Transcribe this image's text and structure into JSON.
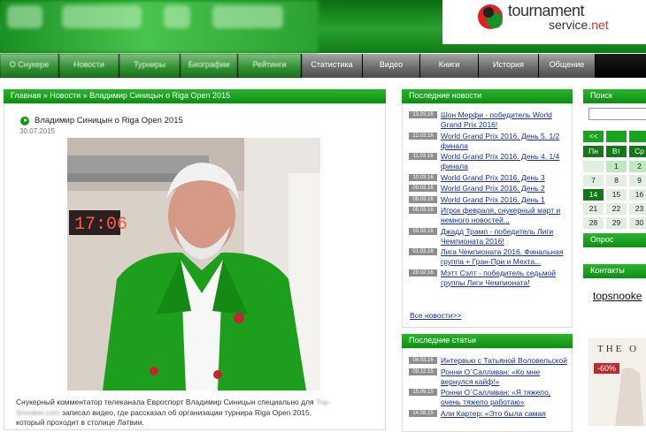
{
  "header": {
    "logo_line1": "tournament",
    "logo_line2": "service",
    "logo_tld": ".net"
  },
  "nav": [
    {
      "label": "О Снукере",
      "w": 67
    },
    {
      "label": "Новости",
      "w": 68
    },
    {
      "label": "Турниры",
      "w": 69
    },
    {
      "label": "Биографии",
      "w": 65
    },
    {
      "label": "Рейтинги",
      "w": 72
    },
    {
      "label": "Статистика",
      "w": 69
    },
    {
      "label": "Видео",
      "w": 65
    },
    {
      "label": "Книги",
      "w": 66
    },
    {
      "label": "История",
      "w": 68
    },
    {
      "label": "Общение",
      "w": 64
    }
  ],
  "breadcrumb": {
    "home": "Главная",
    "sep1": " » ",
    "news": "Новости",
    "sep2": " » ",
    "current": "Владимир Синицын о Riga Open 2015"
  },
  "article": {
    "title": "Владимир Синицын о Riga Open 2015",
    "date": "30.07.2015",
    "line1a": "Снукерный комментатор телеканала Евроспорт Владимир Синицын специально для ",
    "line1b": "Top-",
    "line2a": "Snooker.com",
    "line2b": " записал видео, где рассказал об организации турнира Riga Open 2015,",
    "line3": "который проходит в столице Латвии."
  },
  "latest_news": {
    "header": "Последние новости",
    "items": [
      {
        "date": "13.03.16",
        "title": "Шон Мерфи - победитель World Grand Prix 2016!"
      },
      {
        "date": "12.03.16",
        "title": "World Grand Prix 2016. День 5. 1/2 финала"
      },
      {
        "date": "11.03.16",
        "title": "World Grand Prix 2016. День 4. 1/4 финала"
      },
      {
        "date": "10.03.16",
        "title": "World Grand Prix 2016. День 3"
      },
      {
        "date": "09.03.16",
        "title": "World Grand Prix 2016. День 2"
      },
      {
        "date": "08.03.16",
        "title": "World Grand Prix 2016. День 1"
      },
      {
        "date": "05.03.16",
        "title": "Игрок февраля, снукерный март и немного новостей..."
      },
      {
        "date": "03.03.16",
        "title": "Джадд Трамп - победитель Лиги Чемпионата 2016!"
      },
      {
        "date": "01.03.16",
        "title": "Лига Чемпионата 2016. Финальная группа + Гран-При и Мехта..."
      },
      {
        "date": "29.02.16",
        "title": "Мэтт Сэлт - победитель седьмой группы Лиги Чемпионата!"
      }
    ],
    "all": "Все новости>>"
  },
  "latest_articles": {
    "header": "Последние статьи",
    "items": [
      {
        "date": "04.03.16",
        "title": "Интервью с Татьяной Воловельской"
      },
      {
        "date": "09.12.15",
        "title": "Ронни О`Салливан: «Ко мне вернулся кайф!»"
      },
      {
        "date": "15.09.15",
        "title": "Ронни О`Салливан: «Я тяжело, очень тяжело работаю»"
      },
      {
        "date": "14.08.15",
        "title": "Али Картер: «Это была самая"
      }
    ]
  },
  "sidebar": {
    "search_header": "Поиск",
    "nav_prev": "<<",
    "weekdays": [
      "Пн",
      "Вт",
      "Ср"
    ],
    "weeks": [
      [
        "",
        "1",
        "2"
      ],
      [
        "7",
        "8",
        "9"
      ],
      [
        "14",
        "15",
        "16"
      ],
      [
        "21",
        "22",
        "23"
      ],
      [
        "28",
        "29",
        "30"
      ]
    ],
    "poll_header": "Опрос",
    "contacts_header": "Контакты",
    "contacts_link": "topsnooke",
    "ad_brand": "THE O",
    "ad_sale": "-60%"
  },
  "colors": {
    "green": "#14a01a",
    "link": "#1530a8",
    "date_badge": "#8e8e8e"
  }
}
